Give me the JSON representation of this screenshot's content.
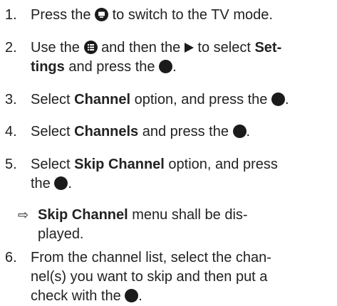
{
  "steps": [
    {
      "num": "1.",
      "a": "Press the",
      "b": "to switch to the TV mode."
    },
    {
      "num": "2.",
      "a": "Use the",
      "b": "and then the",
      "c": "to select",
      "bold": "Set-",
      "bold2": "tings",
      "d": "and press the",
      "e": "."
    },
    {
      "num": "3.",
      "a": "Select",
      "bold": "Channel",
      "b": "option, and press the",
      "c": "."
    },
    {
      "num": "4.",
      "a": "Select",
      "bold": "Channels",
      "b": "and press the",
      "c": "."
    },
    {
      "num": "5.",
      "a": "Select",
      "bold": "Skip Channel",
      "b": "option, and press",
      "c": "the",
      "d": "."
    },
    {
      "num": "6.",
      "a": "From the channel list, select the chan-",
      "b": "nel(s) you want to skip and then put a",
      "c": "check with the",
      "d": "."
    }
  ],
  "result": {
    "arrow": "⇨",
    "bold": "Skip Channel",
    "a": "menu shall be dis-",
    "b": "played."
  },
  "icons": {
    "tv_button": "tv-icon",
    "menu_button": "menu-list-icon",
    "right_arrow": "play-right-icon",
    "ok_button": "ok-dot-icon"
  }
}
